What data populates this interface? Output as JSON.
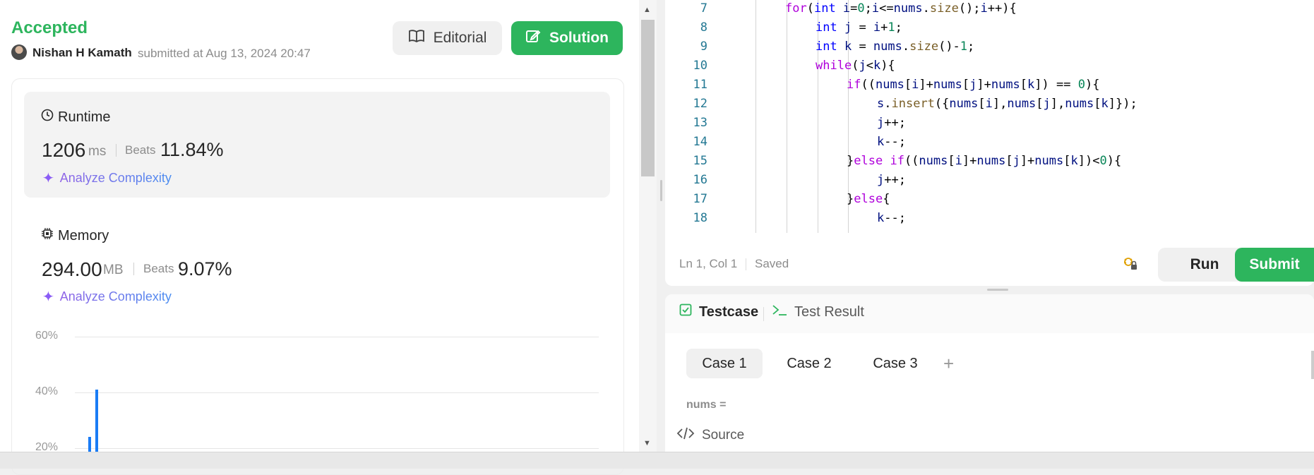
{
  "submission": {
    "status": "Accepted",
    "author": "Nishan H Kamath",
    "submitted_text": "submitted at Aug 13, 2024 20:47",
    "editorial_label": "Editorial",
    "solution_label": "Solution"
  },
  "runtime": {
    "title": "Runtime",
    "value": "1206",
    "unit": "ms",
    "beats_label": "Beats",
    "beats_value": "11.84%",
    "analyze_label": "Analyze Complexity"
  },
  "memory": {
    "title": "Memory",
    "value": "294.00",
    "unit": "MB",
    "beats_label": "Beats",
    "beats_value": "9.07%",
    "analyze_label": "Analyze Complexity"
  },
  "distribution_chart": {
    "y_ticks": [
      "60%",
      "40%",
      "20%"
    ]
  },
  "chart_data": {
    "type": "bar",
    "ylim": [
      0,
      60
    ],
    "grid": true,
    "y_ticks": [
      "60%",
      "40%",
      "20%"
    ],
    "series": [
      {
        "values": [
          24,
          41
        ]
      }
    ]
  },
  "editor": {
    "lines": [
      {
        "n": "7",
        "html": "<span class=\"ctl\">for</span><span class=\"op\">(</span><span class=\"kw\">int</span> i<span class=\"op\">=</span><span class=\"num\">0</span><span class=\"op\">;</span>i<span class=\"op\">&lt;=</span>nums<span class=\"op\">.</span><span class=\"fn\">size</span><span class=\"op\">();</span>i<span class=\"op\">++){</span>",
        "indent": 1
      },
      {
        "n": "8",
        "html": "<span class=\"kw\">int</span> j <span class=\"op\">=</span> i<span class=\"op\">+</span><span class=\"num\">1</span><span class=\"op\">;</span>",
        "indent": 2
      },
      {
        "n": "9",
        "html": "<span class=\"kw\">int</span> k <span class=\"op\">=</span> nums<span class=\"op\">.</span><span class=\"fn\">size</span><span class=\"op\">()-</span><span class=\"num\">1</span><span class=\"op\">;</span>",
        "indent": 2
      },
      {
        "n": "10",
        "html": "<span class=\"ctl\">while</span><span class=\"op\">(</span>j<span class=\"op\">&lt;</span>k<span class=\"op\">){</span>",
        "indent": 2
      },
      {
        "n": "11",
        "html": "<span class=\"ctl\">if</span><span class=\"op\">((</span>nums<span class=\"op\">[</span>i<span class=\"op\">]+</span>nums<span class=\"op\">[</span>j<span class=\"op\">]+</span>nums<span class=\"op\">[</span>k<span class=\"op\">]) ==</span> <span class=\"num\">0</span><span class=\"op\">){</span>",
        "indent": 3
      },
      {
        "n": "12",
        "html": "s<span class=\"op\">.</span><span class=\"fn\">insert</span><span class=\"op\">({</span>nums<span class=\"op\">[</span>i<span class=\"op\">],</span>nums<span class=\"op\">[</span>j<span class=\"op\">],</span>nums<span class=\"op\">[</span>k<span class=\"op\">]});</span>",
        "indent": 4
      },
      {
        "n": "13",
        "html": "j<span class=\"op\">++;</span>",
        "indent": 4
      },
      {
        "n": "14",
        "html": "k<span class=\"op\">--;</span>",
        "indent": 4
      },
      {
        "n": "15",
        "html": "<span class=\"op\">}</span><span class=\"ctl\">else</span> <span class=\"ctl\">if</span><span class=\"op\">((</span>nums<span class=\"op\">[</span>i<span class=\"op\">]+</span>nums<span class=\"op\">[</span>j<span class=\"op\">]+</span>nums<span class=\"op\">[</span>k<span class=\"op\">])&lt;</span><span class=\"num\">0</span><span class=\"op\">){</span>",
        "indent": 3
      },
      {
        "n": "16",
        "html": "j<span class=\"op\">++;</span>",
        "indent": 4
      },
      {
        "n": "17",
        "html": "<span class=\"op\">}</span><span class=\"ctl\">else</span><span class=\"op\">{</span>",
        "indent": 3
      },
      {
        "n": "18",
        "html": "k<span class=\"op\">--;</span>",
        "indent": 4
      }
    ],
    "cursor_status": "Ln 1, Col 1",
    "save_status": "Saved",
    "run_label": "Run",
    "submit_label": "Submit"
  },
  "testcase_panel": {
    "tab_testcase": "Testcase",
    "tab_result": "Test Result",
    "cases": [
      "Case 1",
      "Case 2",
      "Case 3"
    ],
    "add_case": "+",
    "input_label": "nums =",
    "source_label": "Source"
  },
  "colors": {
    "accent_green": "#2db55d",
    "bar_blue": "#1a7cf5"
  }
}
